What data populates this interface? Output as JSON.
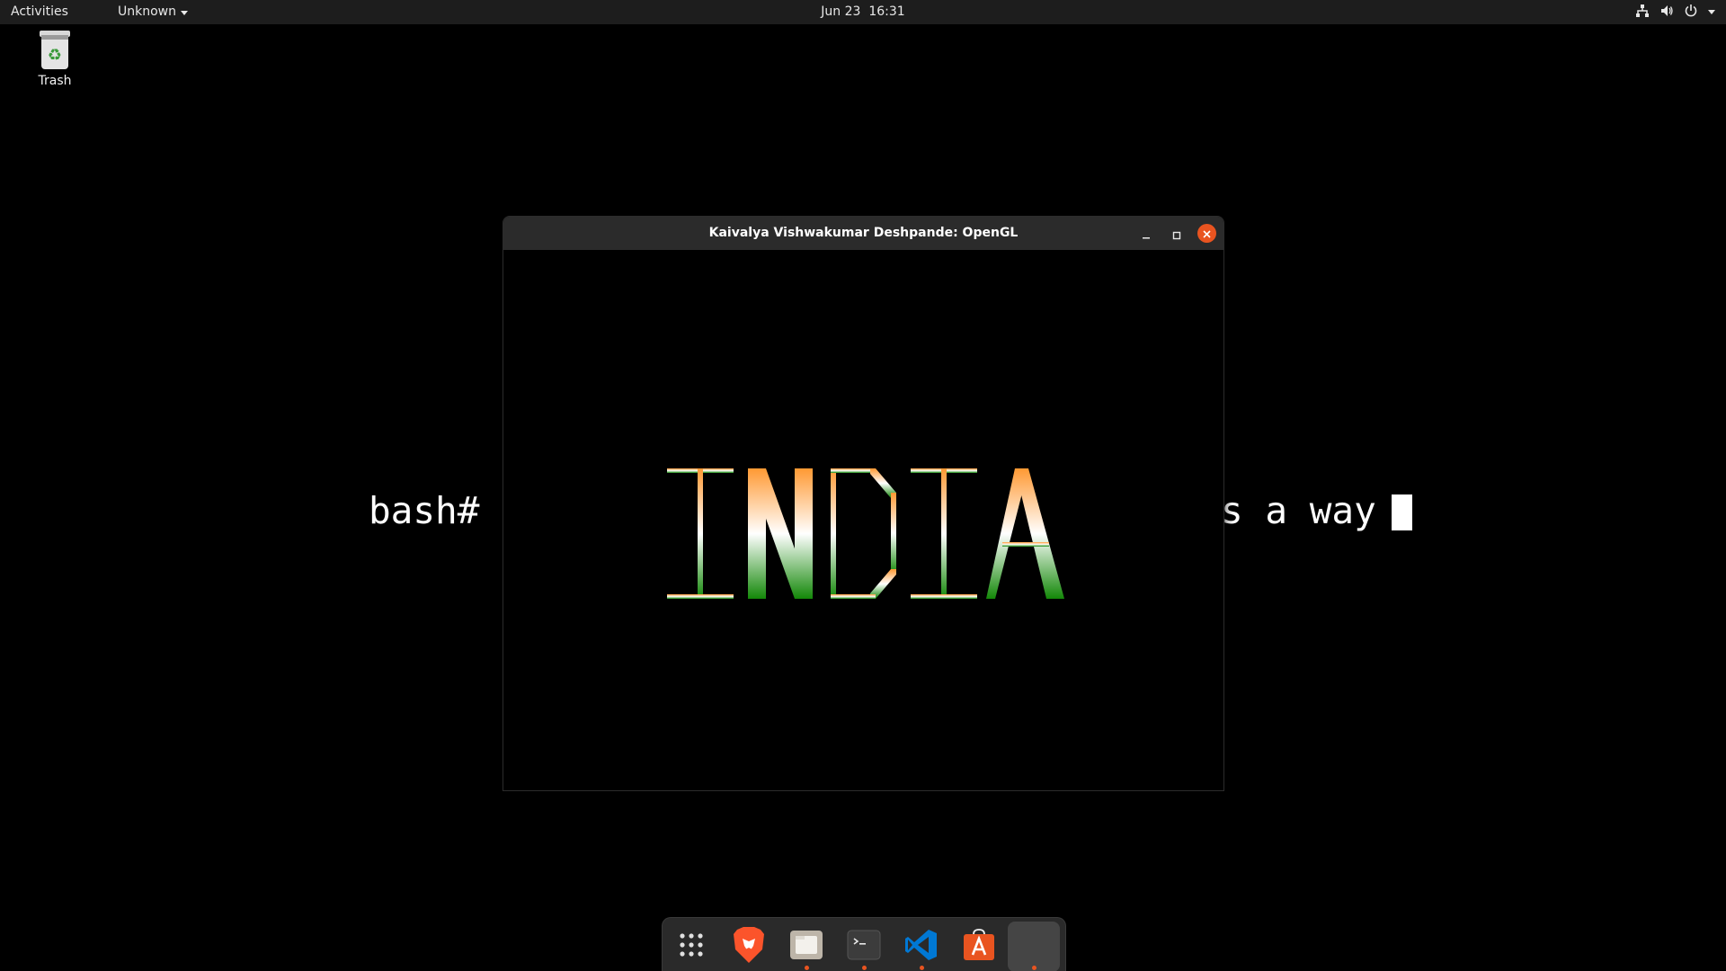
{
  "topbar": {
    "activities": "Activities",
    "app_menu": "Unknown",
    "clock_date": "Jun 23",
    "clock_time": "16:31"
  },
  "desktop": {
    "trash_label": "Trash"
  },
  "terminal": {
    "prompt": "bash#",
    "visible_tail": "s a way"
  },
  "window": {
    "title": "Kaivalya Vishwakumar Deshpande: OpenGL",
    "rendered_text": "INDIA",
    "flag_colors": {
      "saffron": "#FF9933",
      "white": "#FFFFFF",
      "green": "#138808"
    },
    "controls": [
      "minimize-icon",
      "maximize-icon",
      "close-icon"
    ]
  },
  "dock": {
    "items": [
      {
        "name": "show-applications",
        "icon": "app-grid-icon",
        "running": false
      },
      {
        "name": "brave-browser",
        "icon": "brave-lion-icon",
        "running": false
      },
      {
        "name": "files",
        "icon": "folder-icon",
        "running": true
      },
      {
        "name": "terminal",
        "icon": "terminal-icon",
        "running": true
      },
      {
        "name": "vscode",
        "icon": "vscode-icon",
        "running": true
      },
      {
        "name": "software",
        "icon": "software-store-icon",
        "running": false
      },
      {
        "name": "opengl-app",
        "icon": "blank-window-icon",
        "running": true
      }
    ]
  },
  "colors": {
    "accent": "#E95420",
    "topbar": "#1D1D1D",
    "dock": "#2A2A2A",
    "titlebar": "#2B2B2B"
  }
}
